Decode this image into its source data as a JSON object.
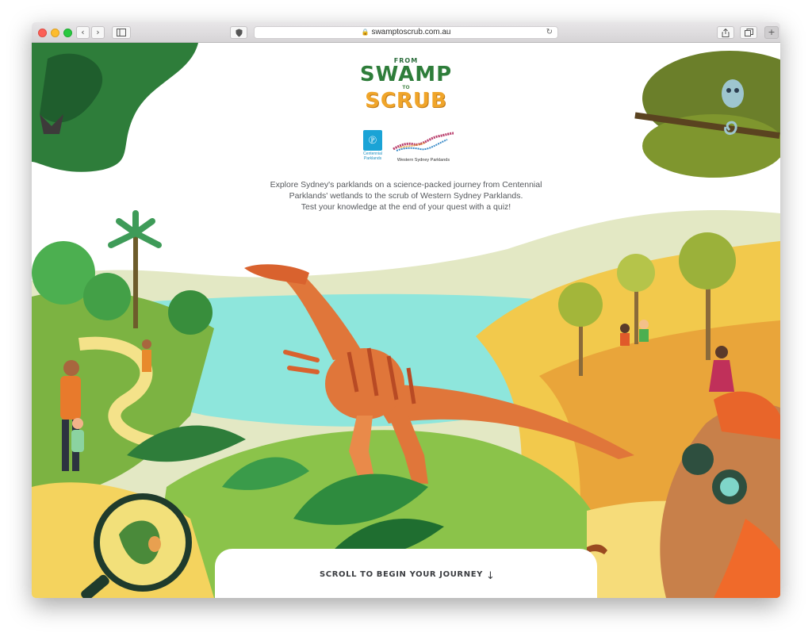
{
  "browser": {
    "url": "swamptoscrub.com.au",
    "back_icon": "chevron-left-icon",
    "forward_icon": "chevron-right-icon",
    "sidebar_icon": "sidebar-icon",
    "privacy_icon": "shield-icon",
    "reload_icon": "reload-icon",
    "share_icon": "share-icon",
    "tabs_icon": "tabs-icon",
    "new_tab_icon": "plus-icon"
  },
  "logo": {
    "line1": "FROM",
    "line2": "SWAMP",
    "line3": "TO",
    "line4": "SCRUB"
  },
  "partners": {
    "centennial": "Centennial Parklands",
    "western": "Western Sydney Parklands"
  },
  "intro": {
    "line1": "Explore Sydney's parklands on a science-packed journey from Centennial",
    "line2": "Parklands' wetlands to the scrub of Western Sydney Parklands.",
    "line3": "Test your knowledge at the end of your quest with a quiz!"
  },
  "cta": {
    "label": "SCROLL TO BEGIN YOUR JOURNEY",
    "arrow": "↓"
  },
  "colors": {
    "sky": "#ffffff",
    "water": "#8ee6dc",
    "grass": "#8bc34a",
    "sand": "#f4d35e",
    "dinosaur": "#e0763a",
    "dark_leaf": "#2e7d3a"
  }
}
